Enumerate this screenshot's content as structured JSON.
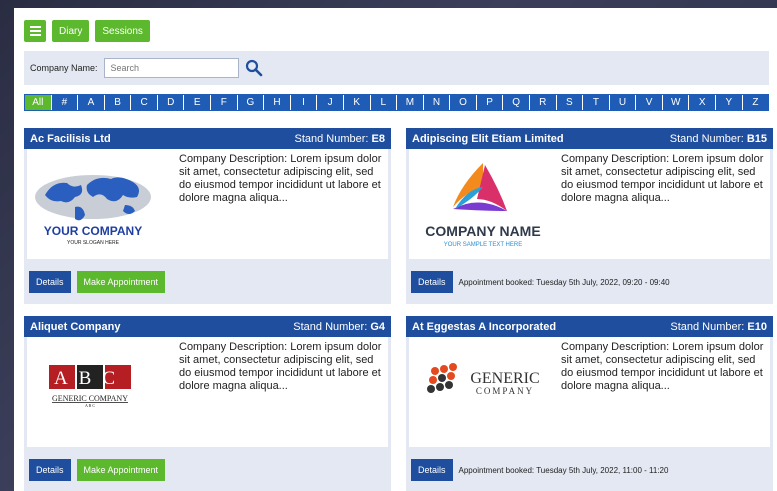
{
  "topbar": {
    "diary": "Diary",
    "sessions": "Sessions"
  },
  "search": {
    "label": "Company Name:",
    "placeholder": "Search"
  },
  "alphabet": [
    "All",
    "#",
    "A",
    "B",
    "C",
    "D",
    "E",
    "F",
    "G",
    "H",
    "I",
    "J",
    "K",
    "L",
    "M",
    "N",
    "O",
    "P",
    "Q",
    "R",
    "S",
    "T",
    "U",
    "V",
    "W",
    "X",
    "Y",
    "Z"
  ],
  "alphabet_active": "All",
  "colors": {
    "green": "#5cb82d",
    "blue": "#1f4e9e",
    "panel": "#e3e8f2"
  },
  "details_label": "Details",
  "appointment_label": "Make Appointment",
  "stand_prefix": "Stand Number: ",
  "description": "Company Description: Lorem ipsum dolor sit amet, consectetur adipiscing elit, sed do eiusmod tempor incididunt ut labore et dolore magna aliqua...",
  "companies": [
    {
      "name": "Ac Facilisis Ltd",
      "stand": "E8",
      "logo_text": "YOUR COMPANY",
      "logo_sub": "YOUR SLOGAN HERE",
      "status": "",
      "action": "appointment"
    },
    {
      "name": "Adipiscing Elit Etiam Limited",
      "stand": "B15",
      "logo_text": "COMPANY NAME",
      "logo_sub": "YOUR SAMPLE TEXT HERE",
      "status": "Appointment booked: Tuesday 5th July, 2022, 09:20 - 09:40",
      "action": "booked"
    },
    {
      "name": "Aliquet Company",
      "stand": "G4",
      "logo_text": "ABC",
      "logo_sub": "GENERIC COMPANY",
      "logo_sub2": "A B C",
      "status": "",
      "action": "appointment"
    },
    {
      "name": "At Eggestas A Incorporated",
      "stand": "E10",
      "logo_text": "GENERIC",
      "logo_sub": "COMPANY",
      "status": "Appointment booked: Tuesday 5th July, 2022, 11:00 - 11:20",
      "action": "booked"
    }
  ]
}
